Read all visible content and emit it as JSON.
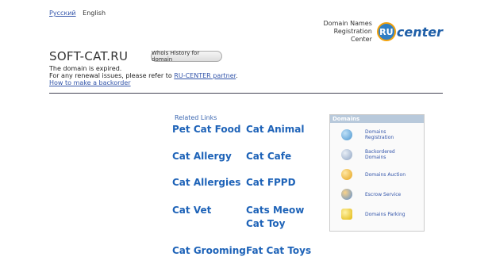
{
  "lang": {
    "russian": "Русский",
    "english": "English"
  },
  "logo": {
    "line1": "Domain Names",
    "line2": "Registration",
    "line3": "Center",
    "badge": "RU",
    "word": "center"
  },
  "domain": "SOFT-CAT.RU",
  "whois_button": "Whois History for domain",
  "info": {
    "line1": "The domain is expired.",
    "line2_prefix": "For any renewal issues, please refer to ",
    "line2_link": "RU-CENTER partner",
    "line2_suffix": ".",
    "backorder": "How to make a backorder"
  },
  "related": {
    "title": "Related Links",
    "links": [
      "Pet Cat Food",
      "Cat Animal",
      "Cat Allergy",
      "Cat Cafe",
      "Cat Allergies",
      "Cat FPPD",
      "Cat Vet",
      "Cats Meow",
      "Cat Toy",
      "Cat Grooming",
      "Fat Cat Toys"
    ]
  },
  "panel": {
    "title": "Domains",
    "items": [
      "Domains Registration",
      "Backordered Domains",
      "Domains Auction",
      "Escrow Service",
      "Domains Parking"
    ]
  }
}
